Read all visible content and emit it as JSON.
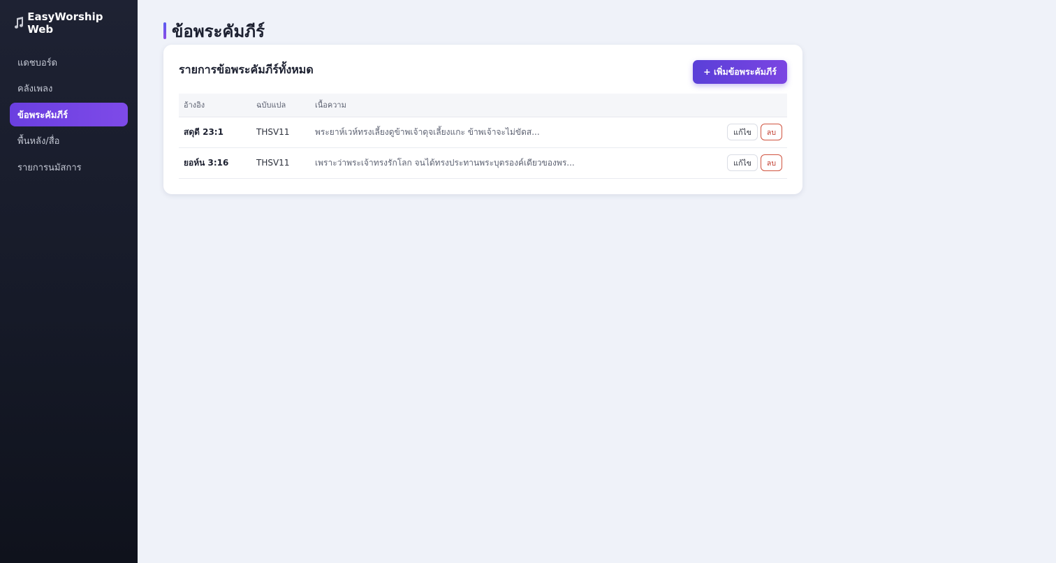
{
  "app": {
    "brand_icon": "music-note-icon",
    "brand_name": "EasyWorship Web"
  },
  "sidebar": {
    "items": [
      {
        "label": "แดชบอร์ด",
        "active": false
      },
      {
        "label": "คลังเพลง",
        "active": false
      },
      {
        "label": "ข้อพระคัมภีร์",
        "active": true
      },
      {
        "label": "พื้นหลัง/สื่อ",
        "active": false
      },
      {
        "label": "รายการนมัสการ",
        "active": false
      }
    ]
  },
  "page": {
    "title": "ข้อพระคัมภีร์"
  },
  "card": {
    "title": "รายการข้อพระคัมภีร์ทั้งหมด",
    "add_button": "+ เพิ่มข้อพระคัมภีร์"
  },
  "table": {
    "headers": [
      "อ้างอิง",
      "ฉบับแปล",
      "เนื้อความ",
      ""
    ],
    "rows": [
      {
        "reference": "สดุดี 23:1",
        "version": "THSV11",
        "text": "พระยาห์เวห์ทรงเลี้ยงดูข้าพเจ้าดุจเลี้ยงแกะ ข้าพเจ้าจะไม่ขัดส...",
        "edit_label": "แก้ไข",
        "delete_label": "ลบ"
      },
      {
        "reference": "ยอห์น 3:16",
        "version": "THSV11",
        "text": "เพราะว่าพระเจ้าทรงรักโลก จนได้ทรงประทานพระบุตรองค์เดียวของพร...",
        "edit_label": "แก้ไข",
        "delete_label": "ลบ"
      }
    ]
  },
  "colors": {
    "accent": "#6a3fe0",
    "sidebar_bg": "#1a1e2c",
    "page_bg": "#eff2f9",
    "danger": "#c0392b"
  }
}
